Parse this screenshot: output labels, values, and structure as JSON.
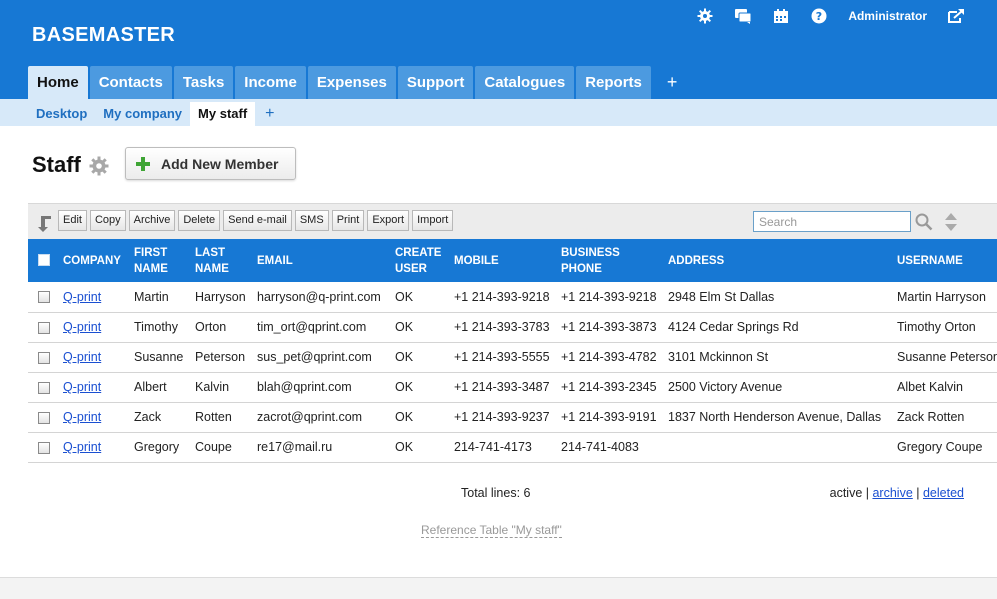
{
  "app": {
    "logo": "BASEMASTER",
    "user": "Administrator"
  },
  "top_icons": [
    "gear-icon",
    "chat-icon",
    "calendar-icon",
    "help-icon"
  ],
  "main_tabs": [
    {
      "label": "Home",
      "active": true
    },
    {
      "label": "Contacts"
    },
    {
      "label": "Tasks"
    },
    {
      "label": "Income"
    },
    {
      "label": "Expenses"
    },
    {
      "label": "Support"
    },
    {
      "label": "Catalogues"
    },
    {
      "label": "Reports"
    },
    {
      "label": "+"
    }
  ],
  "sub_tabs": [
    {
      "label": "Desktop"
    },
    {
      "label": "My company"
    },
    {
      "label": "My staff",
      "active": true
    },
    {
      "label": "+"
    }
  ],
  "page": {
    "title": "Staff",
    "add_button": "Add New Member"
  },
  "toolbar": {
    "buttons": [
      "Edit",
      "Copy",
      "Archive",
      "Delete",
      "Send e-mail",
      "SMS",
      "Print",
      "Export",
      "Import"
    ],
    "search_placeholder": "Search"
  },
  "table": {
    "headers": [
      "COMPANY",
      "FIRST NAME",
      "LAST NAME",
      "EMAIL",
      "CREATE USER",
      "MOBILE",
      "BUSINESS PHONE",
      "ADDRESS",
      "USERNAME"
    ],
    "rows": [
      [
        "Q-print",
        "Martin",
        "Harryson",
        "harryson@q-print.com",
        "OK",
        "+1 214-393-9218",
        "+1 214-393-9218",
        "2948 Elm St Dallas",
        "Martin Harryson"
      ],
      [
        "Q-print",
        "Timothy",
        "Orton",
        "tim_ort@qprint.com",
        "OK",
        "+1 214-393-3783",
        "+1 214-393-3873",
        "4124 Cedar Springs Rd",
        "Timothy Orton"
      ],
      [
        "Q-print",
        "Susanne",
        "Peterson",
        "sus_pet@qprint.com",
        "OK",
        "+1 214-393-5555",
        "+1 214-393-4782",
        "3101 Mckinnon St",
        "Susanne Peterson"
      ],
      [
        "Q-print",
        "Albert",
        "Kalvin",
        "blah@qprint.com",
        "OK",
        "+1 214-393-3487",
        "+1 214-393-2345",
        "2500 Victory Avenue",
        "Albet Kalvin"
      ],
      [
        "Q-print",
        "Zack",
        "Rotten",
        "zacrot@qprint.com",
        "OK",
        "+1 214-393-9237",
        "+1 214-393-9191",
        "1837 North Henderson Avenue, Dallas",
        "Zack Rotten"
      ],
      [
        "Q-print",
        "Gregory",
        "Coupe",
        "re17@mail.ru",
        "OK",
        "214-741-4173",
        "214-741-4083",
        "",
        "Gregory Coupe"
      ]
    ]
  },
  "footer": {
    "total": "Total lines: 6",
    "filter_active": "active",
    "filter_sep": " | ",
    "filter_archive": "archive",
    "filter_deleted": "deleted",
    "reference": "Reference Table \"My staff\""
  },
  "colors": {
    "brand": "#1778d4",
    "tab": "#4c9ae0",
    "subbar": "#d7e9f9",
    "link": "#1a4fd1"
  }
}
